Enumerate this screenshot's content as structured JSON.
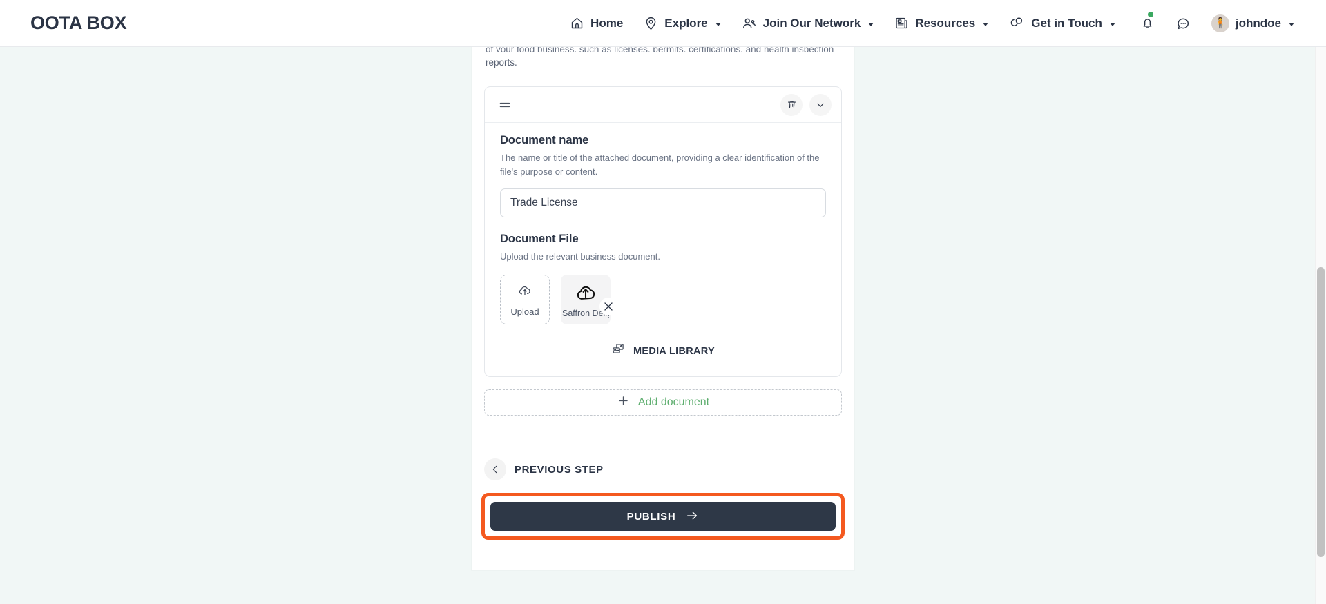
{
  "navbar": {
    "brand": "OOTA BOX",
    "links": [
      {
        "label": "Home",
        "icon": "home-icon",
        "has_caret": false
      },
      {
        "label": "Explore",
        "icon": "location-pin-icon",
        "has_caret": true
      },
      {
        "label": "Join Our Network",
        "icon": "users-icon",
        "has_caret": true
      },
      {
        "label": "Resources",
        "icon": "news-article-icon",
        "has_caret": true
      },
      {
        "label": "Get in Touch",
        "icon": "chat-bubbles-icon",
        "has_caret": true
      }
    ],
    "notification_icon": "bell-icon",
    "notification_dot_color": "#3aa860",
    "message_icon": "message-bubble-icon",
    "avatar_icon": "user-avatar",
    "user_name": "johndoe"
  },
  "main": {
    "intro_line1": "of your food business, such as licenses, permits, certifications, and health inspection",
    "intro_line2": "reports.",
    "document_card": {
      "drag_handle_icon": "drag-handle-icon",
      "delete_icon": "trash-icon",
      "collapse_icon": "chevron-down-icon",
      "name_field": {
        "label": "Document name",
        "help": "The name or title of the attached document, providing a clear identification of the file's purpose or content.",
        "value": "Trade License",
        "placeholder": "Trade License"
      },
      "file_field": {
        "label": "Document File",
        "help": "Upload the relevant business document.",
        "upload_box": {
          "icon": "cloud-upload-icon",
          "label": "Upload"
        },
        "attached_file": {
          "icon": "cloud-upload-icon",
          "name": "Saffron Delig",
          "remove_icon": "close-x-icon"
        },
        "media_library": {
          "icon": "media-library-icon",
          "label": "MEDIA LIBRARY"
        }
      }
    },
    "add_document": {
      "icon": "plus-icon",
      "label": "Add document",
      "color": "#5eae6f"
    },
    "previous_step": {
      "icon": "chevron-left-icon",
      "label": "PREVIOUS STEP"
    },
    "publish": {
      "label": "PUBLISH",
      "icon": "arrow-right-icon",
      "highlight_color": "#f4591f",
      "button_color": "#2e3847"
    }
  },
  "page_background": "#f1f7f6"
}
